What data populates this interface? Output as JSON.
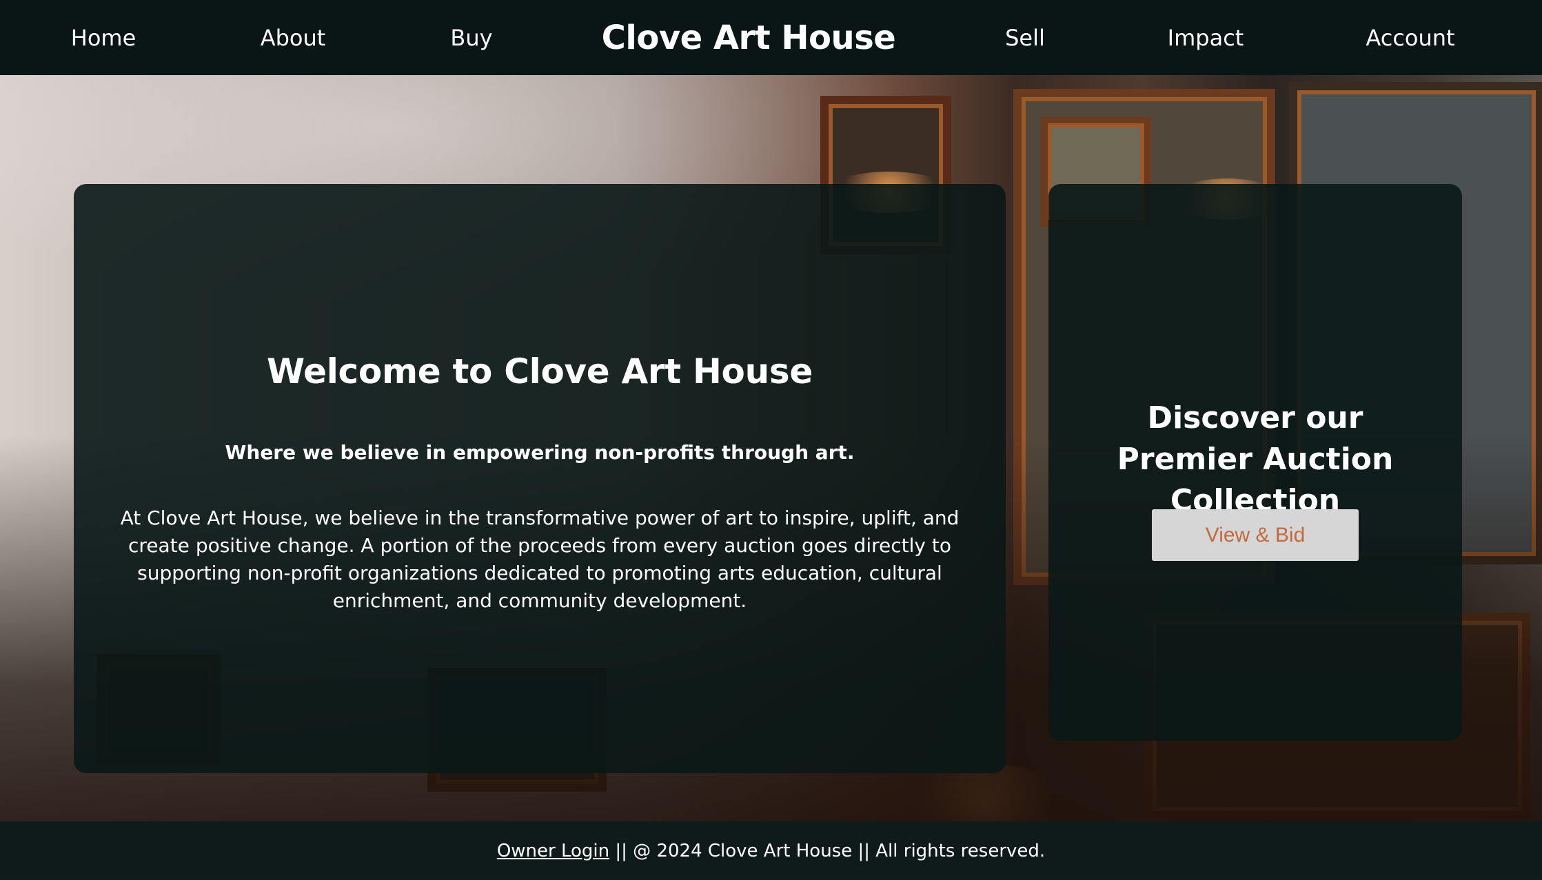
{
  "nav": {
    "home": "Home",
    "about": "About",
    "buy": "Buy",
    "brand": "Clove Art House",
    "sell": "Sell",
    "impact": "Impact",
    "account": "Account"
  },
  "welcome": {
    "title": "Welcome to Clove Art House",
    "subtitle": "Where we believe in empowering non-profits through art.",
    "body": "At Clove Art House, we believe in the transformative power of art to inspire, uplift, and create positive change. A portion of the proceeds from every auction goes directly to supporting non-profit organizations dedicated to promoting arts education, cultural enrichment, and community development."
  },
  "auction": {
    "title": "Discover our Premier Auction Collection",
    "button_label": "View & Bid"
  },
  "footer": {
    "owner_login": "Owner Login",
    "copyright": " || @ 2024 Clove Art House || All rights reserved."
  },
  "colors": {
    "nav_bg": "#0a1616",
    "card_bg": "#0a1817",
    "button_bg": "#d6d6d6",
    "button_text": "#c26a3e"
  }
}
